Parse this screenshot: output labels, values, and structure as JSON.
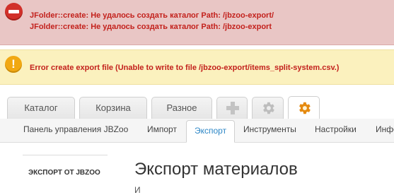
{
  "alerts": {
    "error": {
      "icon": "no-entry-icon",
      "color": "#c3211c",
      "lines": [
        "JFolder::create: Не удалось создать каталог Path: /jbzoo-export/",
        "JFolder::create: Не удалось создать каталог Path: /jbzoo-export"
      ]
    },
    "warning": {
      "icon": "warning-exclamation-icon",
      "text": "Error create export file (Unable to write to file /jbzoo-export/items_split-system.csv.)"
    }
  },
  "tabs": [
    {
      "label": "Каталог"
    },
    {
      "label": "Корзина"
    },
    {
      "label": "Разное"
    },
    {
      "icon": "plus-icon"
    },
    {
      "icon": "gear-icon"
    },
    {
      "icon": "orange-gear-icon",
      "active": true
    }
  ],
  "subnav": {
    "items": [
      {
        "label": "Панель управления JBZoo"
      },
      {
        "label": "Импорт"
      },
      {
        "label": "Экспорт",
        "active": true
      },
      {
        "label": "Инструменты"
      },
      {
        "label": "Настройки"
      },
      {
        "label": "Инфо"
      }
    ]
  },
  "sidebar": {
    "heading": "Экспорт от JBZoo"
  },
  "main": {
    "title": "Экспорт материалов",
    "cut_text": "И"
  },
  "colors": {
    "error_bg": "#e9c6c5",
    "warning_bg": "#fbf1be",
    "active_link": "#2c86c6"
  }
}
